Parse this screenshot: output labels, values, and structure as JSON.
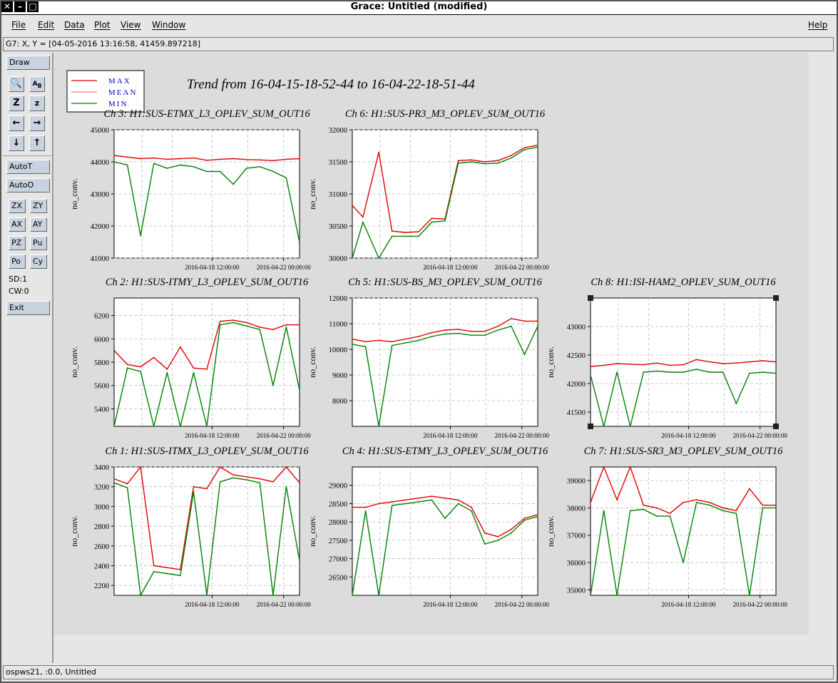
{
  "window": {
    "title": "Grace: Untitled (modified)"
  },
  "menubar": {
    "file": "File",
    "edit": "Edit",
    "data": "Data",
    "plot": "Plot",
    "view": "View",
    "window": "Window",
    "help": "Help"
  },
  "locator": "G7: X, Y = [04-05-2016 13:16:58, 41459.897218]",
  "toolbar": {
    "draw": "Draw",
    "autot": "AutoT",
    "autoo": "AutoO",
    "zx": "ZX",
    "zy": "ZY",
    "ax": "AX",
    "ay": "AY",
    "pz": "PZ",
    "pu": "Pu",
    "po": "Po",
    "cy": "Cy",
    "sd": "SD:1",
    "cw": "CW:0",
    "exit": "Exit"
  },
  "status": "ospws21, :0.0, Untitled",
  "plot_title": "Trend from 16-04-15-18-52-44 to 16-04-22-18-51-44",
  "legend": [
    {
      "name": "MAX",
      "color": "#e00000"
    },
    {
      "name": "MEAN",
      "color": "#f08080"
    },
    {
      "name": "MIN",
      "color": "#008000"
    }
  ],
  "colors": {
    "max": "#e00000",
    "min": "#008000",
    "legend_text": "#0000cc"
  },
  "chart_data": [
    {
      "type": "line",
      "title": "Ch 3: H1:SUS-ETMX_L3_OPLEV_SUM_OUT16",
      "ylabel": "no_conv.",
      "ylim": [
        41000,
        45000
      ],
      "yticks": [
        41000,
        42000,
        43000,
        44000,
        45000
      ],
      "xticks": [
        "2016-04-18 12:00:00",
        "2016-04-22 00:00:00"
      ],
      "series": [
        {
          "name": "MAX",
          "x": [
            0,
            0.5,
            1,
            1.5,
            2,
            2.5,
            3,
            3.5,
            4,
            4.5,
            5,
            5.5,
            6,
            6.5,
            7
          ],
          "values": [
            44200,
            44150,
            44100,
            44120,
            44080,
            44100,
            44120,
            44050,
            44080,
            44100,
            44070,
            44060,
            44040,
            44080,
            44100
          ]
        },
        {
          "name": "MIN",
          "x": [
            0,
            0.5,
            1,
            1.5,
            2,
            2.5,
            3,
            3.5,
            4,
            4.5,
            5,
            5.5,
            6,
            6.5,
            7
          ],
          "values": [
            44000,
            43900,
            41700,
            43950,
            43800,
            43900,
            43850,
            43700,
            43700,
            43300,
            43800,
            43850,
            43700,
            43500,
            41500
          ]
        }
      ]
    },
    {
      "type": "line",
      "title": "Ch 6: H1:SUS-PR3_M3_OPLEV_SUM_OUT16",
      "ylabel": "no_conv.",
      "ylim": [
        30000,
        32000
      ],
      "yticks": [
        30000,
        30500,
        31000,
        31500,
        32000
      ],
      "xticks": [
        "2016-04-18 12:00:00",
        "2016-04-22 00:00:00"
      ],
      "series": [
        {
          "name": "MAX",
          "x": [
            0,
            0.4,
            1,
            1.5,
            2,
            2.5,
            3,
            3.5,
            4,
            4.5,
            5,
            5.5,
            6,
            6.5,
            7
          ],
          "values": [
            30820,
            30640,
            31650,
            30420,
            30400,
            30410,
            30620,
            30610,
            31520,
            31530,
            31500,
            31520,
            31600,
            31720,
            31760
          ]
        },
        {
          "name": "MIN",
          "x": [
            0,
            0.4,
            1,
            1.5,
            2,
            2.5,
            3,
            3.5,
            4,
            4.5,
            5,
            5.5,
            6,
            6.5,
            7
          ],
          "values": [
            30000,
            30560,
            30000,
            30340,
            30340,
            30340,
            30560,
            30580,
            31480,
            31500,
            31470,
            31480,
            31560,
            31690,
            31730
          ]
        }
      ]
    },
    {
      "type": "line",
      "title": "Ch 2: H1:SUS-ITMY_L3_OPLEV_SUM_OUT16",
      "ylabel": "no_conv.",
      "ylim": [
        5250,
        6350
      ],
      "yticks": [
        5400,
        5600,
        5800,
        6000,
        6200
      ],
      "xticks": [
        "2016-04-18 12:00:00",
        "2016-04-22 00:00:00"
      ],
      "series": [
        {
          "name": "MAX",
          "x": [
            0,
            0.5,
            1,
            1.5,
            2,
            2.5,
            3,
            3.5,
            4,
            4.5,
            5,
            5.5,
            6,
            6.5,
            7
          ],
          "values": [
            5900,
            5780,
            5760,
            5840,
            5740,
            5930,
            5750,
            5740,
            6150,
            6160,
            6140,
            6100,
            6080,
            6120,
            6120
          ]
        },
        {
          "name": "MIN",
          "x": [
            0,
            0.5,
            1,
            1.5,
            2,
            2.5,
            3,
            3.5,
            4,
            4.5,
            5,
            5.5,
            6,
            6.5,
            7
          ],
          "values": [
            5250,
            5750,
            5720,
            5250,
            5710,
            5250,
            5710,
            5250,
            6120,
            6140,
            6110,
            6080,
            5600,
            6100,
            5560
          ]
        }
      ]
    },
    {
      "type": "line",
      "title": "Ch 5: H1:SUS-BS_M3_OPLEV_SUM_OUT16",
      "ylabel": "no_conv.",
      "ylim": [
        7000,
        12000
      ],
      "yticks": [
        8000,
        9000,
        10000,
        11000,
        12000
      ],
      "xticks": [
        "2016-04-18 12:00:00",
        "2016-04-22 00:00:00"
      ],
      "series": [
        {
          "name": "MAX",
          "x": [
            0,
            0.5,
            1,
            1.5,
            2,
            2.5,
            3,
            3.5,
            4,
            4.5,
            5,
            5.5,
            6,
            6.5,
            7
          ],
          "values": [
            10400,
            10300,
            10350,
            10300,
            10400,
            10500,
            10650,
            10750,
            10780,
            10700,
            10700,
            10900,
            11200,
            11100,
            11100
          ]
        },
        {
          "name": "MIN",
          "x": [
            0,
            0.5,
            1,
            1.5,
            2,
            2.5,
            3,
            3.5,
            4,
            4.5,
            5,
            5.5,
            6,
            6.5,
            7
          ],
          "values": [
            10200,
            10100,
            7000,
            10150,
            10250,
            10350,
            10500,
            10600,
            10620,
            10550,
            10550,
            10750,
            10900,
            9800,
            10900
          ]
        }
      ]
    },
    {
      "type": "line",
      "title": "Ch 8: H1:ISI-HAM2_OPLEV_SUM_OUT16",
      "ylabel": "no_conv.",
      "ylim": [
        41250,
        43500
      ],
      "yticks": [
        41500,
        42000,
        42500,
        43000
      ],
      "xticks": [
        "2016-04-18 12:00:00",
        "2016-04-22 00:00:00"
      ],
      "series": [
        {
          "name": "MAX",
          "x": [
            0,
            0.5,
            1,
            1.5,
            2,
            2.5,
            3,
            3.5,
            4,
            4.5,
            5,
            5.5,
            6,
            6.5,
            7
          ],
          "values": [
            42300,
            42320,
            42350,
            42340,
            42330,
            42360,
            42320,
            42330,
            42420,
            42380,
            42350,
            42360,
            42380,
            42400,
            42380
          ]
        },
        {
          "name": "MIN",
          "x": [
            0,
            0.5,
            1,
            1.5,
            2,
            2.5,
            3,
            3.5,
            4,
            4.5,
            5,
            5.5,
            6,
            6.5,
            7
          ],
          "values": [
            42150,
            41250,
            42200,
            41250,
            42200,
            42220,
            42200,
            42200,
            42250,
            42200,
            42200,
            41650,
            42180,
            42200,
            42180
          ]
        }
      ]
    },
    {
      "type": "line",
      "title": "Ch 1: H1:SUS-ITMX_L3_OPLEV_SUM_OUT16",
      "ylabel": "no_conv.",
      "ylim": [
        2100,
        3400
      ],
      "yticks": [
        2200,
        2400,
        2600,
        2800,
        3000,
        3200,
        3400
      ],
      "xticks": [
        "2016-04-18 12:00:00",
        "2016-04-22 00:00:00"
      ],
      "series": [
        {
          "name": "MAX",
          "x": [
            0,
            0.5,
            1,
            1.5,
            2,
            2.5,
            3,
            3.5,
            4,
            4.5,
            5,
            5.5,
            6,
            6.5,
            7
          ],
          "values": [
            3280,
            3230,
            3400,
            2400,
            2380,
            2360,
            3200,
            3180,
            3400,
            3320,
            3300,
            3280,
            3250,
            3400,
            3240
          ]
        },
        {
          "name": "MIN",
          "x": [
            0,
            0.5,
            1,
            1.5,
            2,
            2.5,
            3,
            3.5,
            4,
            4.5,
            5,
            5.5,
            6,
            6.5,
            7
          ],
          "values": [
            3240,
            3190,
            2100,
            2340,
            2320,
            2300,
            3150,
            2100,
            3250,
            3290,
            3270,
            3240,
            2100,
            3200,
            2450
          ]
        }
      ]
    },
    {
      "type": "line",
      "title": "Ch 4: H1:SUS-ETMY_L3_OPLEV_SUM_OUT16",
      "ylabel": "no_conv.",
      "ylim": [
        26000,
        29500
      ],
      "yticks": [
        26500,
        27000,
        27500,
        28000,
        28500,
        29000
      ],
      "xticks": [
        "2016-04-18 12:00:00",
        "2016-04-22 00:00:00"
      ],
      "series": [
        {
          "name": "MAX",
          "x": [
            0,
            0.5,
            1,
            1.5,
            2,
            2.5,
            3,
            3.5,
            4,
            4.5,
            5,
            5.5,
            6,
            6.5,
            7
          ],
          "values": [
            28400,
            28400,
            28500,
            28550,
            28600,
            28650,
            28700,
            28650,
            28600,
            28400,
            27700,
            27600,
            27800,
            28100,
            28200
          ]
        },
        {
          "name": "MIN",
          "x": [
            0,
            0.5,
            1,
            1.5,
            2,
            2.5,
            3,
            3.5,
            4,
            4.5,
            5,
            5.5,
            6,
            6.5,
            7
          ],
          "values": [
            26000,
            28300,
            26000,
            28450,
            28500,
            28550,
            28600,
            28100,
            28500,
            28300,
            27400,
            27500,
            27700,
            28050,
            28150
          ]
        }
      ]
    },
    {
      "type": "line",
      "title": "Ch 7: H1:SUS-SR3_M3_OPLEV_SUM_OUT16",
      "ylabel": "no_conv.",
      "ylim": [
        34800,
        39500
      ],
      "yticks": [
        35000,
        36000,
        37000,
        38000,
        39000
      ],
      "xticks": [
        "2016-04-18 12:00:00",
        "2016-04-22 00:00:00"
      ],
      "series": [
        {
          "name": "MAX",
          "x": [
            0,
            0.5,
            1,
            1.5,
            2,
            2.5,
            3,
            3.5,
            4,
            4.5,
            5,
            5.5,
            6,
            6.5,
            7
          ],
          "values": [
            38200,
            39500,
            38300,
            39500,
            38100,
            38000,
            37800,
            38200,
            38300,
            38200,
            38000,
            37900,
            38700,
            38100,
            38100
          ]
        },
        {
          "name": "MIN",
          "x": [
            0,
            0.5,
            1,
            1.5,
            2,
            2.5,
            3,
            3.5,
            4,
            4.5,
            5,
            5.5,
            6,
            6.5,
            7
          ],
          "values": [
            34800,
            37900,
            34800,
            37900,
            37950,
            37700,
            37700,
            36000,
            38200,
            38100,
            37900,
            37800,
            34800,
            38000,
            38000
          ]
        }
      ]
    }
  ]
}
